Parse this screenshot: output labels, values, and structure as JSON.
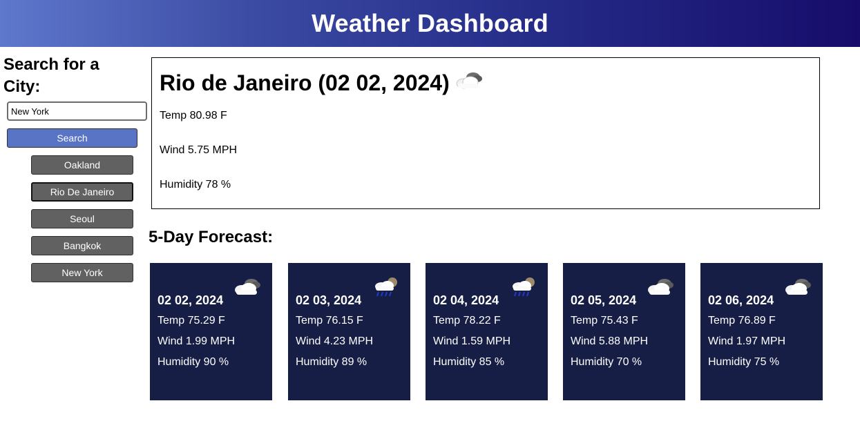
{
  "header": {
    "title": "Weather Dashboard"
  },
  "sidebar": {
    "heading": "Search for a City:",
    "search_value": "New York",
    "search_label": "Search",
    "history": [
      "Oakland",
      "Rio De Janeiro",
      "Seoul",
      "Bangkok",
      "New York"
    ]
  },
  "current": {
    "title": "Rio de Janeiro (02 02, 2024)",
    "icon": "partly-cloudy-icon",
    "temp": "Temp 80.98 F",
    "wind": "Wind 5.75 MPH",
    "humidity": "Humidity 78 %"
  },
  "forecast": {
    "title": "5-Day Forecast:",
    "days": [
      {
        "date": "02 02, 2024",
        "icon": "partly-cloudy-icon",
        "temp": "Temp 75.29 F",
        "wind": "Wind 1.99 MPH",
        "humidity": "Humidity 90 %"
      },
      {
        "date": "02 03, 2024",
        "icon": "night-rain-icon",
        "temp": "Temp 76.15 F",
        "wind": "Wind 4.23 MPH",
        "humidity": "Humidity 89 %"
      },
      {
        "date": "02 04, 2024",
        "icon": "night-rain-icon",
        "temp": "Temp 78.22 F",
        "wind": "Wind 1.59 MPH",
        "humidity": "Humidity 85 %"
      },
      {
        "date": "02 05, 2024",
        "icon": "partly-cloudy-icon",
        "temp": "Temp 75.43 F",
        "wind": "Wind 5.88 MPH",
        "humidity": "Humidity 70 %"
      },
      {
        "date": "02 06, 2024",
        "icon": "partly-cloudy-icon",
        "temp": "Temp 76.89 F",
        "wind": "Wind 1.97 MPH",
        "humidity": "Humidity 75 %"
      }
    ]
  },
  "colors": {
    "header_start": "#5e78cc",
    "header_end": "#170c6a",
    "search_button": "#5a74c5",
    "history_button": "#616161",
    "card_bg": "#161e45"
  }
}
